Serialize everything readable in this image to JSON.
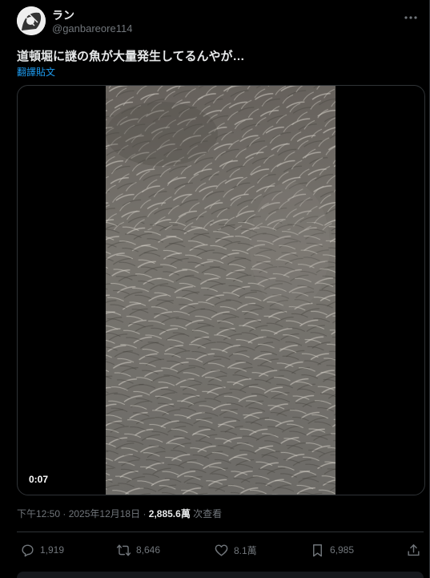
{
  "author": {
    "name": "ラン",
    "handle": "@ganbareore114"
  },
  "tweet": {
    "text": "道頓堀に謎の魚が大量発生してるんやが…",
    "translate_label": "翻譯貼文"
  },
  "media": {
    "duration": "0:07"
  },
  "meta": {
    "time": "下午12:50",
    "separator1": " · ",
    "date": "2025年12月18日",
    "separator2": " · ",
    "views_count": "2,885.6萬",
    "views_label": " 次查看"
  },
  "actions": {
    "reply_count": "1,919",
    "retweet_count": "8,646",
    "like_count": "8.1萬",
    "bookmark_count": "6,985"
  },
  "icons": {
    "more": "more-horizontal-icon",
    "reply": "reply-icon",
    "retweet": "retweet-icon",
    "like": "heart-icon",
    "bookmark": "bookmark-icon",
    "share": "share-icon"
  },
  "colors": {
    "background": "#000000",
    "link": "#1d9bf0",
    "muted": "#71767b",
    "text": "#e7e9ea"
  }
}
